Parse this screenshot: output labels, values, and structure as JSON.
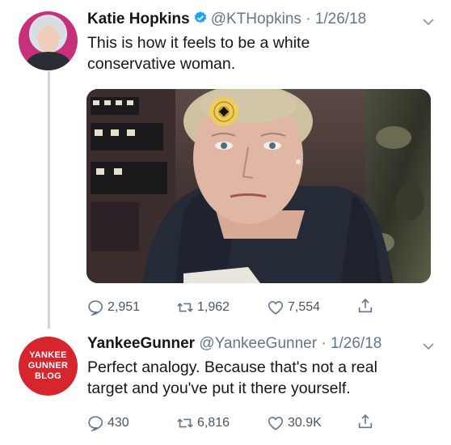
{
  "tweet1": {
    "name": "Katie Hopkins",
    "handle": "@KTHopkins",
    "separator": "·",
    "date": "1/26/18",
    "text_line1": "This is how it feels to be a white",
    "text_line2": "conservative woman.",
    "replies": "2,951",
    "retweets": "1,962",
    "likes": "7,554"
  },
  "tweet2": {
    "name": "YankeeGunner",
    "handle": "@YankeeGunner",
    "separator": "·",
    "date": "1/26/18",
    "text_line1": "Perfect analogy. Because that's not a real",
    "text_line2": "target and you've put it there yourself.",
    "replies": "430",
    "retweets": "6,816",
    "likes": "30.9K",
    "avatar_line1": "YANKEE",
    "avatar_line2": "GUNNER",
    "avatar_line3": "BLOG"
  },
  "colors": {
    "verified_blue": "#1da1f2",
    "secondary_text": "#657786",
    "avatar_red": "#d6252d",
    "thread_line": "#ccd6dd"
  }
}
